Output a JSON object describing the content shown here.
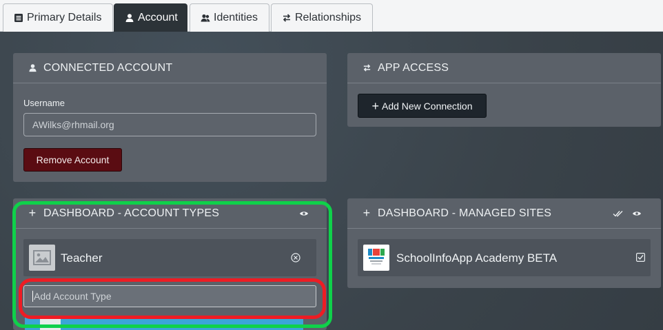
{
  "tabs": [
    {
      "label": "Primary Details",
      "icon": "list-icon"
    },
    {
      "label": "Account",
      "icon": "user-icon",
      "active": true
    },
    {
      "label": "Identities",
      "icon": "users-icon"
    },
    {
      "label": "Relationships",
      "icon": "swap-icon"
    }
  ],
  "connected_account": {
    "title": "CONNECTED ACCOUNT",
    "username_label": "Username",
    "username_value": "AWilks@rhmail.org",
    "remove_button": "Remove Account"
  },
  "app_access": {
    "title": "APP ACCESS",
    "add_button": "Add New Connection"
  },
  "account_types": {
    "title": "DASHBOARD - ACCOUNT TYPES",
    "items": [
      {
        "label": "Teacher"
      }
    ],
    "add_placeholder": "Add Account Type"
  },
  "managed_sites": {
    "title": "DASHBOARD - MANAGED SITES",
    "items": [
      {
        "label": "SchoolInfoApp Academy BETA"
      }
    ]
  },
  "colors": {
    "green_highlight": "#0fd14a",
    "red_highlight": "#ee1c24",
    "danger": "#5a0c12",
    "dark_button": "#1e252c"
  }
}
